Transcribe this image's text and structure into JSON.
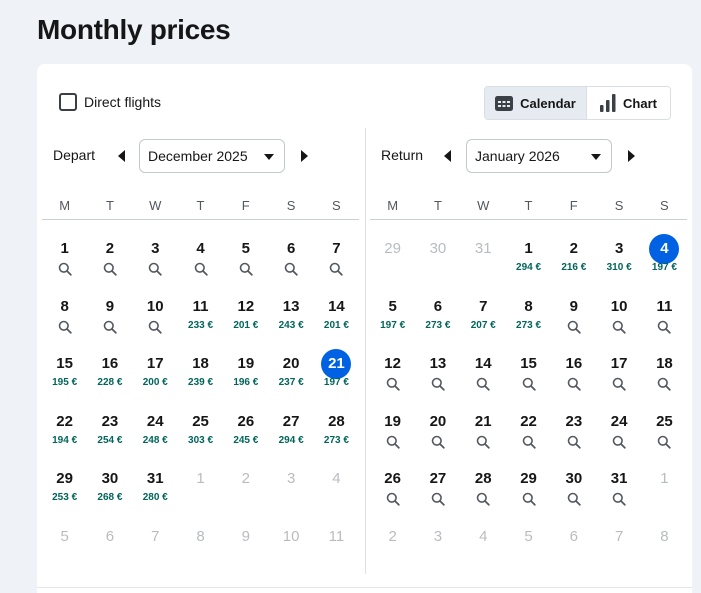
{
  "page_title": "Monthly prices",
  "direct_flights_label": "Direct flights",
  "direct_flights_checked": false,
  "view_toggle": {
    "calendar_label": "Calendar",
    "chart_label": "Chart",
    "active": "calendar"
  },
  "weekdays": [
    "M",
    "T",
    "W",
    "T",
    "F",
    "S",
    "S"
  ],
  "depart": {
    "label": "Depart",
    "month": "December 2025",
    "days": [
      {
        "d": "1",
        "t": "search"
      },
      {
        "d": "2",
        "t": "search"
      },
      {
        "d": "3",
        "t": "search"
      },
      {
        "d": "4",
        "t": "search"
      },
      {
        "d": "5",
        "t": "search"
      },
      {
        "d": "6",
        "t": "search"
      },
      {
        "d": "7",
        "t": "search"
      },
      {
        "d": "8",
        "t": "search"
      },
      {
        "d": "9",
        "t": "search"
      },
      {
        "d": "10",
        "t": "search"
      },
      {
        "d": "11",
        "p": "233 €"
      },
      {
        "d": "12",
        "p": "201 €"
      },
      {
        "d": "13",
        "p": "243 €"
      },
      {
        "d": "14",
        "p": "201 €"
      },
      {
        "d": "15",
        "p": "195 €"
      },
      {
        "d": "16",
        "p": "228 €"
      },
      {
        "d": "17",
        "p": "200 €"
      },
      {
        "d": "18",
        "p": "239 €"
      },
      {
        "d": "19",
        "p": "196 €"
      },
      {
        "d": "20",
        "p": "237 €"
      },
      {
        "d": "21",
        "p": "197 €",
        "sel": true
      },
      {
        "d": "22",
        "p": "194 €"
      },
      {
        "d": "23",
        "p": "254 €"
      },
      {
        "d": "24",
        "p": "248 €"
      },
      {
        "d": "25",
        "p": "303 €"
      },
      {
        "d": "26",
        "p": "245 €"
      },
      {
        "d": "27",
        "p": "294 €"
      },
      {
        "d": "28",
        "p": "273 €"
      },
      {
        "d": "29",
        "p": "253 €"
      },
      {
        "d": "30",
        "p": "268 €"
      },
      {
        "d": "31",
        "p": "280 €"
      },
      {
        "d": "1",
        "muted": true
      },
      {
        "d": "2",
        "muted": true
      },
      {
        "d": "3",
        "muted": true
      },
      {
        "d": "4",
        "muted": true
      },
      {
        "d": "5",
        "muted": true
      },
      {
        "d": "6",
        "muted": true
      },
      {
        "d": "7",
        "muted": true
      },
      {
        "d": "8",
        "muted": true
      },
      {
        "d": "9",
        "muted": true
      },
      {
        "d": "10",
        "muted": true
      },
      {
        "d": "11",
        "muted": true
      }
    ]
  },
  "return": {
    "label": "Return",
    "month": "January 2026",
    "days": [
      {
        "d": "29",
        "muted": true
      },
      {
        "d": "30",
        "muted": true
      },
      {
        "d": "31",
        "muted": true
      },
      {
        "d": "1",
        "p": "294 €"
      },
      {
        "d": "2",
        "p": "216 €"
      },
      {
        "d": "3",
        "p": "310 €"
      },
      {
        "d": "4",
        "p": "197 €",
        "sel": true
      },
      {
        "d": "5",
        "p": "197 €"
      },
      {
        "d": "6",
        "p": "273 €"
      },
      {
        "d": "7",
        "p": "207 €"
      },
      {
        "d": "8",
        "p": "273 €"
      },
      {
        "d": "9",
        "t": "search"
      },
      {
        "d": "10",
        "t": "search"
      },
      {
        "d": "11",
        "t": "search"
      },
      {
        "d": "12",
        "t": "search"
      },
      {
        "d": "13",
        "t": "search"
      },
      {
        "d": "14",
        "t": "search"
      },
      {
        "d": "15",
        "t": "search"
      },
      {
        "d": "16",
        "t": "search"
      },
      {
        "d": "17",
        "t": "search"
      },
      {
        "d": "18",
        "t": "search"
      },
      {
        "d": "19",
        "t": "search"
      },
      {
        "d": "20",
        "t": "search"
      },
      {
        "d": "21",
        "t": "search"
      },
      {
        "d": "22",
        "t": "search"
      },
      {
        "d": "23",
        "t": "search"
      },
      {
        "d": "24",
        "t": "search"
      },
      {
        "d": "25",
        "t": "search"
      },
      {
        "d": "26",
        "t": "search"
      },
      {
        "d": "27",
        "t": "search"
      },
      {
        "d": "28",
        "t": "search"
      },
      {
        "d": "29",
        "t": "search"
      },
      {
        "d": "30",
        "t": "search"
      },
      {
        "d": "31",
        "t": "search"
      },
      {
        "d": "1",
        "muted": true
      },
      {
        "d": "2",
        "muted": true
      },
      {
        "d": "3",
        "muted": true
      },
      {
        "d": "4",
        "muted": true
      },
      {
        "d": "5",
        "muted": true
      },
      {
        "d": "6",
        "muted": true
      },
      {
        "d": "7",
        "muted": true
      },
      {
        "d": "8",
        "muted": true
      }
    ]
  },
  "colors": {
    "accent": "#0062e3",
    "price": "#00655a",
    "muted": "#b8bcc2"
  }
}
